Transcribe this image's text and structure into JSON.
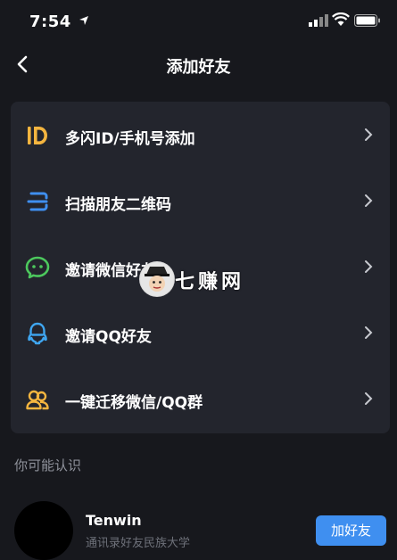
{
  "status": {
    "time": "7:54"
  },
  "nav": {
    "title": "添加好友"
  },
  "menu": [
    {
      "label": "多闪ID/手机号添加",
      "icon": "id-icon",
      "color": "#f4b53f"
    },
    {
      "label": "扫描朋友二维码",
      "icon": "scan-icon",
      "color": "#3f8ff0"
    },
    {
      "label": "邀请微信好友",
      "icon": "wechat-icon",
      "color": "#4cc85d"
    },
    {
      "label": "邀请QQ好友",
      "icon": "qq-icon",
      "color": "#3fa6f0"
    },
    {
      "label": "一键迁移微信/QQ群",
      "icon": "group-icon",
      "color": "#f4b53f"
    }
  ],
  "watermark": {
    "text": "七赚网"
  },
  "suggest": {
    "title": "你可能认识"
  },
  "contact": {
    "name": "Tenwin",
    "subtitle": "通讯录好友民族大学",
    "button": "加好友"
  },
  "colors": {
    "background": "#17181d",
    "card": "#23252d",
    "accent": "#3f8ff0"
  }
}
